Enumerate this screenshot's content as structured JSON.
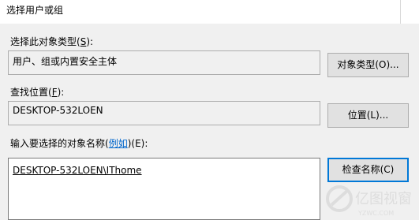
{
  "title": "选择用户或组",
  "object_type": {
    "label_prefix": "选择此对象类型(",
    "label_key": "S",
    "label_suffix": "):",
    "value": "用户、组或内置安全主体",
    "button_label": "对象类型(O)..."
  },
  "location": {
    "label_prefix": "查找位置(",
    "label_key": "F",
    "label_suffix": "):",
    "value": "DESKTOP-532LOEN",
    "button_label": "位置(L)..."
  },
  "names": {
    "label_prefix": "输入要选择的对象名称(",
    "label_link": "例如",
    "label_suffix": ")(E):",
    "value": "DESKTOP-532LOEN\\IThome",
    "button_label": "检查名称(C)"
  },
  "watermark": {
    "text": "亿图视窗",
    "sub": "YZWC.COM"
  }
}
